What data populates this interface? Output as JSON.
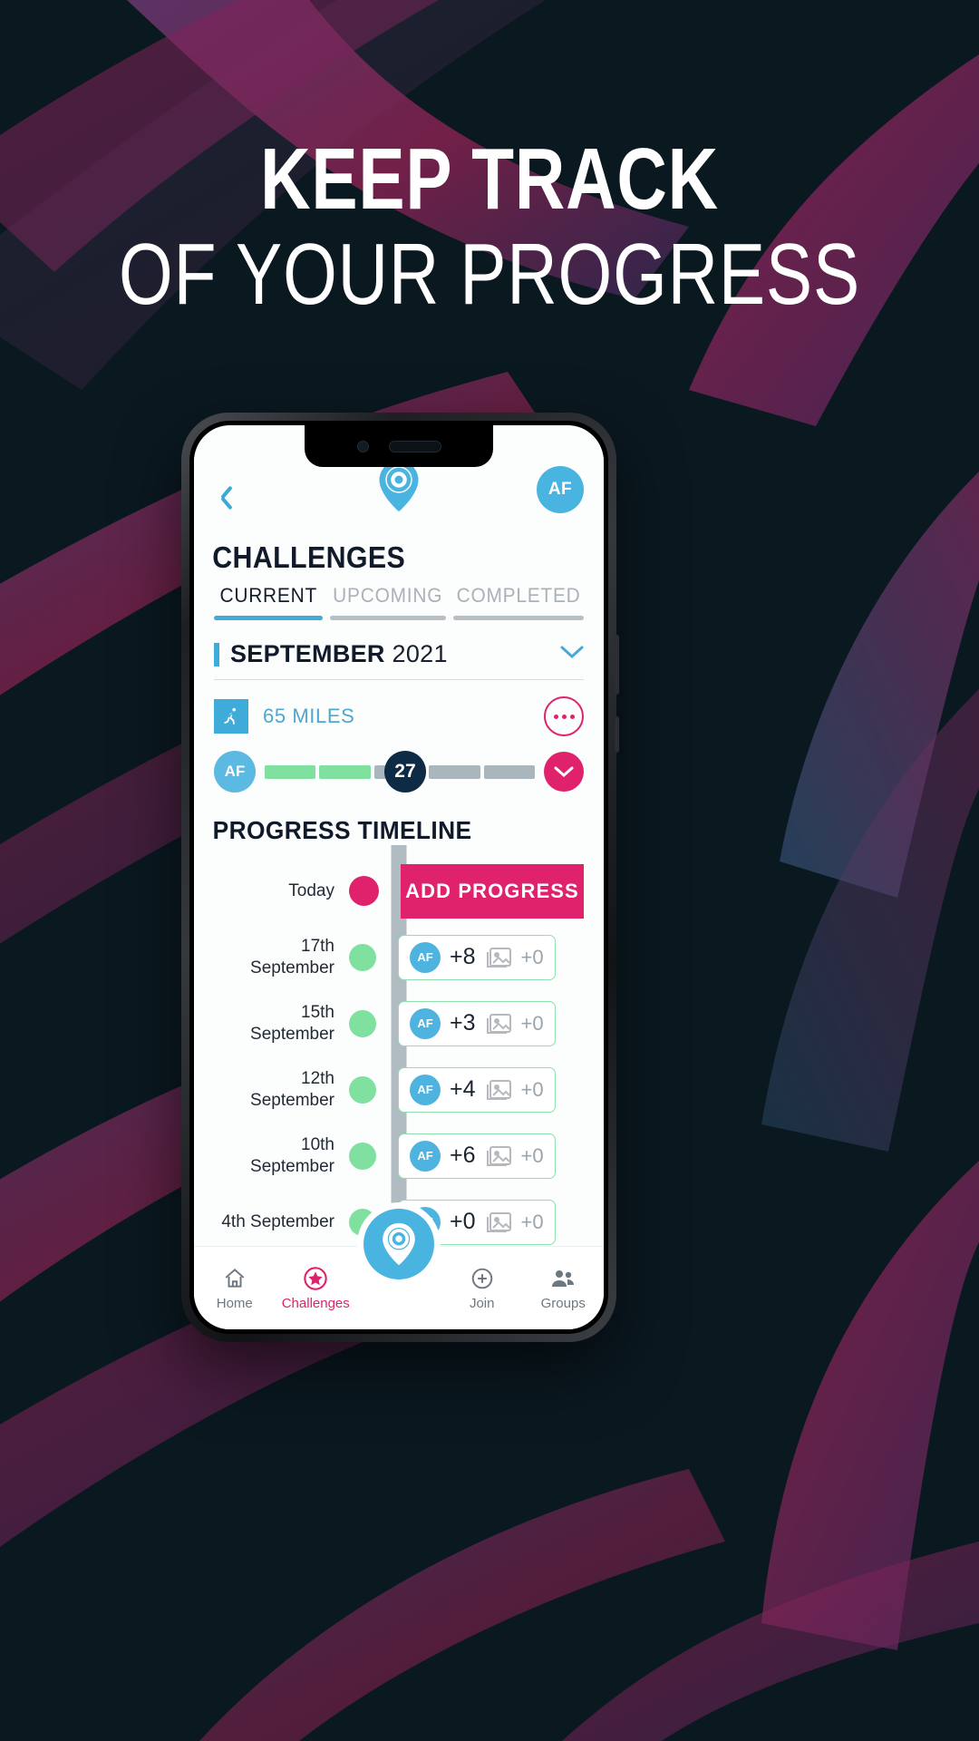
{
  "promo": {
    "line1": "KEEP TRACK",
    "line2": "OF YOUR PROGRESS",
    "bg_color": "#0a1820",
    "accent_magenta": "#8c2352",
    "accent_purple": "#5b3a6e"
  },
  "app": {
    "topbar": {
      "back_icon": "chevron-left-icon",
      "logo_icon": "target-pin-icon",
      "avatar_initials": "AF"
    },
    "page_title": "CHALLENGES",
    "tabs": [
      {
        "label": "CURRENT",
        "active": true
      },
      {
        "label": "UPCOMING",
        "active": false
      },
      {
        "label": "COMPLETED",
        "active": false
      }
    ],
    "month_selector": {
      "month": "SEPTEMBER",
      "year": "2021",
      "chevron_icon": "chevron-down-icon"
    },
    "challenge": {
      "activity_icon": "running-icon",
      "goal": "65 MILES",
      "more_icon": "more-dots-icon",
      "expand_icon": "chevron-down-icon",
      "avatar_initials": "AF",
      "current_value": "27",
      "segments": [
        {
          "state": "done"
        },
        {
          "state": "done"
        },
        {
          "state": "todo"
        },
        {
          "state": "todo"
        },
        {
          "state": "todo"
        }
      ]
    },
    "timeline": {
      "title": "PROGRESS TIMELINE",
      "add_button": "ADD PROGRESS",
      "today_label": "Today",
      "entries": [
        {
          "date": "17th September",
          "avatar": "AF",
          "value": "+8",
          "photos": "+0"
        },
        {
          "date": "15th September",
          "avatar": "AF",
          "value": "+3",
          "photos": "+0"
        },
        {
          "date": "12th September",
          "avatar": "AF",
          "value": "+4",
          "photos": "+0"
        },
        {
          "date": "10th September",
          "avatar": "AF",
          "value": "+6",
          "photos": "+0"
        },
        {
          "date": "4th September",
          "avatar": "AF",
          "value": "+0",
          "photos": "+0"
        }
      ]
    },
    "bottom_nav": [
      {
        "label": "Home",
        "icon": "home-icon",
        "active": false
      },
      {
        "label": "Challenges",
        "icon": "challenges-star-icon",
        "active": true
      },
      {
        "label": "Join",
        "icon": "plus-circle-icon",
        "active": false
      },
      {
        "label": "Groups",
        "icon": "groups-icon",
        "active": false
      }
    ],
    "fab_icon": "target-pin-icon",
    "colors": {
      "primary_blue": "#3fabd9",
      "accent_pink": "#e0216c",
      "progress_green": "#7fe0a0",
      "dark_navy": "#0d2b45"
    }
  }
}
